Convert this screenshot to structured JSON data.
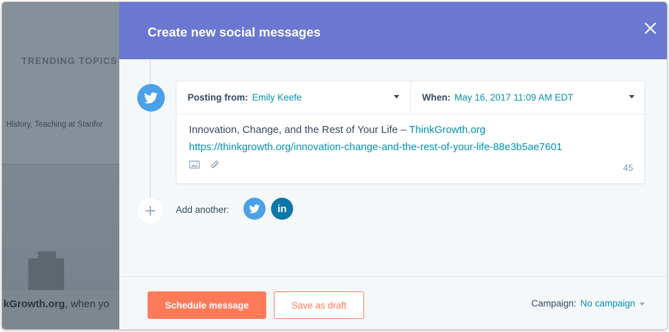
{
  "background": {
    "trending_heading": "TRENDING TOPICS",
    "topics_text": "History, Teaching at Stanfor",
    "caption_bold": "kGrowth.org",
    "caption_rest": ", when yo"
  },
  "modal": {
    "title": "Create new social messages",
    "close_icon": "close-icon",
    "accent_color": "#6a78d1",
    "message": {
      "network_icon": "twitter-icon",
      "posting_from_label": "Posting from:",
      "posting_from_value": "Emily Keefe",
      "when_label": "When:",
      "when_value": "May 16, 2017 11:09 AM EDT",
      "body_text": "Innovation, Change, and the Rest of Your Life – ",
      "body_link_text": "ThinkGrowth.org",
      "body_url": "https://thinkgrowth.org/innovation-change-and-the-rest-of-your-life-88e3b5ae7601",
      "character_count": "45"
    },
    "add_another": {
      "label": "Add another:",
      "networks": [
        "twitter-icon",
        "linkedin-icon"
      ],
      "linkedin_text": "in"
    },
    "footer": {
      "schedule_label": "Schedule message",
      "draft_label": "Save as draft",
      "campaign_label": "Campaign:",
      "campaign_value": "No campaign",
      "primary_color": "#ff7a59"
    }
  }
}
